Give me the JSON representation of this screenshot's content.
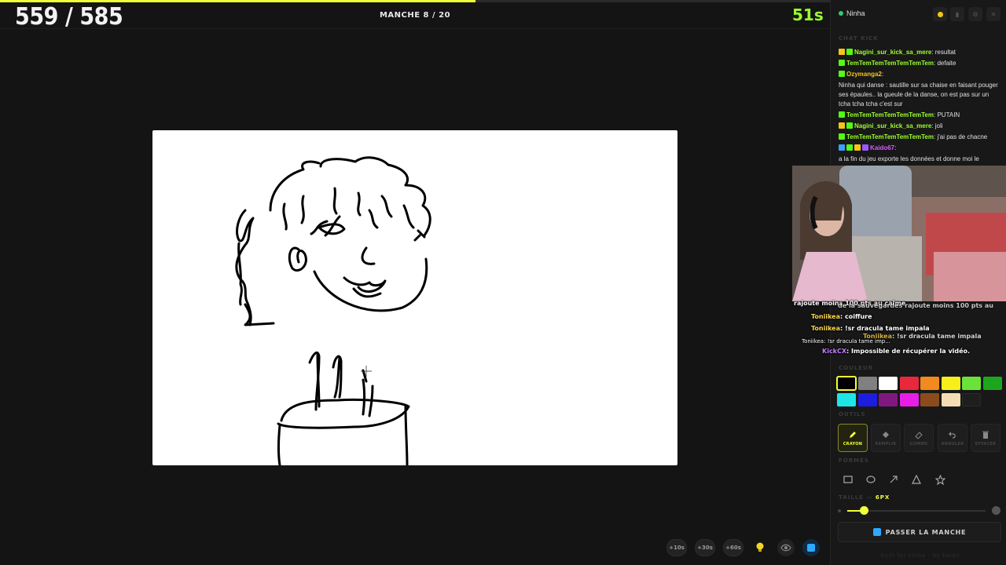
{
  "game": {
    "score": "559 / 585",
    "round": "MANCHE 8 / 20",
    "timer": "51s",
    "progress": 0.573,
    "accent_color": "#f2ff3a",
    "timer_color": "#9dff2e"
  },
  "bottom_tools": {
    "add_10": "+10s",
    "add_30": "+30s",
    "add_60": "+60s",
    "hint_icon": "lightbulb-icon",
    "view_icon": "eye-icon",
    "kick_icon": "kick-logo-icon"
  },
  "panel": {
    "username": "Ninha",
    "chat_title": "CHAT KICK",
    "chat": [
      {
        "user": "Nagini_sur_kick_sa_mere",
        "text": "resultat"
      },
      {
        "user": "TemTemTemTemTemTemTem",
        "text": "defaite"
      },
      {
        "user": "Ozymanga2",
        "text": ""
      },
      {
        "user": "",
        "text": "Ninha qui danse : sautille sur sa chaise en faisant pouger ses épaules.. la gueule de la danse, on est pas sur un tcha tcha tcha c'est sur"
      },
      {
        "user": "TemTemTemTemTemTemTem",
        "text": "PUTAIN"
      },
      {
        "user": "Nagini_sur_kick_sa_mere",
        "text": "joli"
      },
      {
        "user": "TemTemTemTemTemTemTem",
        "text": "j'ai pas de chacne"
      },
      {
        "user": "Kaido67",
        "text": ""
      },
      {
        "user": "",
        "text": "a la fin du jeu exporte les données et donne moi le"
      }
    ],
    "overlay_chat": [
      {
        "user": "",
        "text": "rajoute moins 100 pts au calme"
      },
      {
        "user": "",
        "text": "de la sauvegardes rajoute moins 100 pts au"
      },
      {
        "user": "Toniikea",
        "text": "coiffure"
      },
      {
        "user": "Toniikea",
        "text": "!sr dracula tame impala"
      },
      {
        "user": "Toniikea",
        "text": "!sr dracula tame impala"
      },
      {
        "user": "Toniikea",
        "text": "!sr dracula tame imp..."
      },
      {
        "user": "KickCX",
        "text": "Impossible de récupérer la vidéo."
      }
    ],
    "colors_label": "COULEUR",
    "colors": [
      "#000000",
      "#808080",
      "#ffffff",
      "#e8283c",
      "#f38a1d",
      "#f7ee1b",
      "#6be23a",
      "#1ea51e",
      "#1ee6e6",
      "#1d1ddf",
      "#7f197f",
      "#e61ee6",
      "#8b4b1b",
      "#f5dcb4"
    ],
    "tools_label": "OUTILS",
    "tools": [
      {
        "label": "CRAYON",
        "icon": "pencil-icon"
      },
      {
        "label": "REMPLIR",
        "icon": "bucket-icon"
      },
      {
        "label": "GOMME",
        "icon": "eraser-icon"
      },
      {
        "label": "ANNULER",
        "icon": "undo-icon"
      },
      {
        "label": "EFFACER",
        "icon": "trash-icon"
      }
    ],
    "shapes_label": "FORMES",
    "shapes": [
      "rectangle-icon",
      "ellipse-icon",
      "arrow-icon",
      "triangle-icon",
      "star-icon"
    ],
    "size_label": "TAILLE — ",
    "size_value": "6PX",
    "size_fraction": 0.12,
    "skip_label": "PASSER LA MANCHE",
    "footer": "built for ninha · by kaido"
  }
}
